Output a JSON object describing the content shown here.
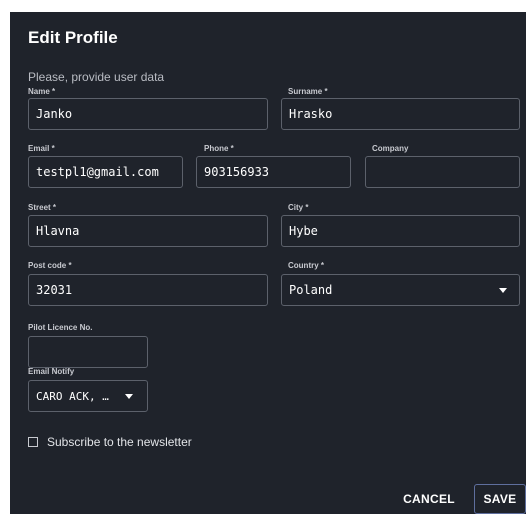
{
  "dialog": {
    "title": "Edit Profile",
    "subtitle": "Please, provide user data"
  },
  "form": {
    "name": {
      "label": "Name *",
      "value": "Janko"
    },
    "surname": {
      "label": "Surname *",
      "value": "Hrasko"
    },
    "email": {
      "label": "Email *",
      "value": "testpl1@gmail.com"
    },
    "phone": {
      "label": "Phone *",
      "value": "903156933"
    },
    "company": {
      "label": "Company",
      "value": ""
    },
    "street": {
      "label": "Street *",
      "value": "Hlavna"
    },
    "city": {
      "label": "City *",
      "value": "Hybe"
    },
    "postcode": {
      "label": "Post code *",
      "value": "32031"
    },
    "country": {
      "label": "Country *",
      "value": "Poland"
    },
    "pilot_licence": {
      "label": "Pilot Licence No.",
      "value": ""
    },
    "email_notify": {
      "label": "Email Notify",
      "value": "CARO ACK, …"
    },
    "newsletter": {
      "label": "Subscribe to the newsletter",
      "checked": false
    }
  },
  "actions": {
    "cancel_label": "CANCEL",
    "save_label": "SAVE"
  },
  "colors": {
    "dialog_bg": "#1f232b",
    "field_border": "#5c616b",
    "save_border": "#5f6f9e"
  }
}
